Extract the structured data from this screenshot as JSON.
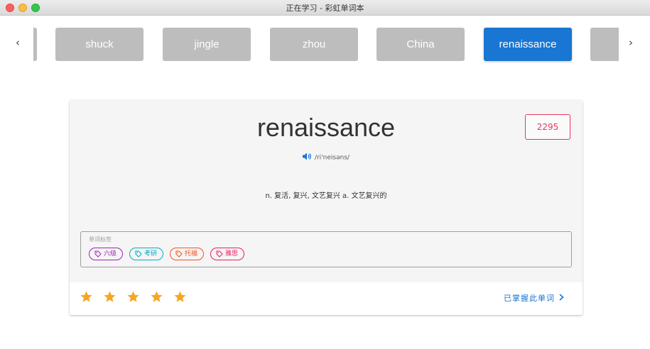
{
  "window": {
    "title": "正在学习 - 彩虹单词本"
  },
  "strip": {
    "prev_icon": "chevron-left-icon",
    "next_icon": "chevron-right-icon",
    "prev_glyph": "‹",
    "next_glyph": "›",
    "words": [
      {
        "label": "shuck",
        "active": false
      },
      {
        "label": "jingle",
        "active": false
      },
      {
        "label": "zhou",
        "active": false
      },
      {
        "label": "China",
        "active": false
      },
      {
        "label": "renaissance",
        "active": true
      }
    ],
    "chip_color": "#bdbdbd",
    "active_color": "#1976d2"
  },
  "card": {
    "word": "renaissance",
    "count": "2295",
    "phonetic": "/ri'neisəns/",
    "speaker_icon": "speaker-icon",
    "definition": "n. 复活, 复兴, 文艺复兴 a. 文艺复兴的",
    "tags_label": "单词标签",
    "tags": [
      {
        "label": "六级",
        "color": "#9c27b0",
        "icon": "tag-icon"
      },
      {
        "label": "考研",
        "color": "#00acc1",
        "icon": "tag-icon"
      },
      {
        "label": "托福",
        "color": "#f4511e",
        "icon": "tag-icon"
      },
      {
        "label": "雅思",
        "color": "#e91e63",
        "icon": "tag-icon"
      }
    ],
    "rating": 5,
    "rating_max": 5,
    "star_color": "#f5a623",
    "mastered_label": "已掌握此单词",
    "mastered_glyph": "›"
  }
}
